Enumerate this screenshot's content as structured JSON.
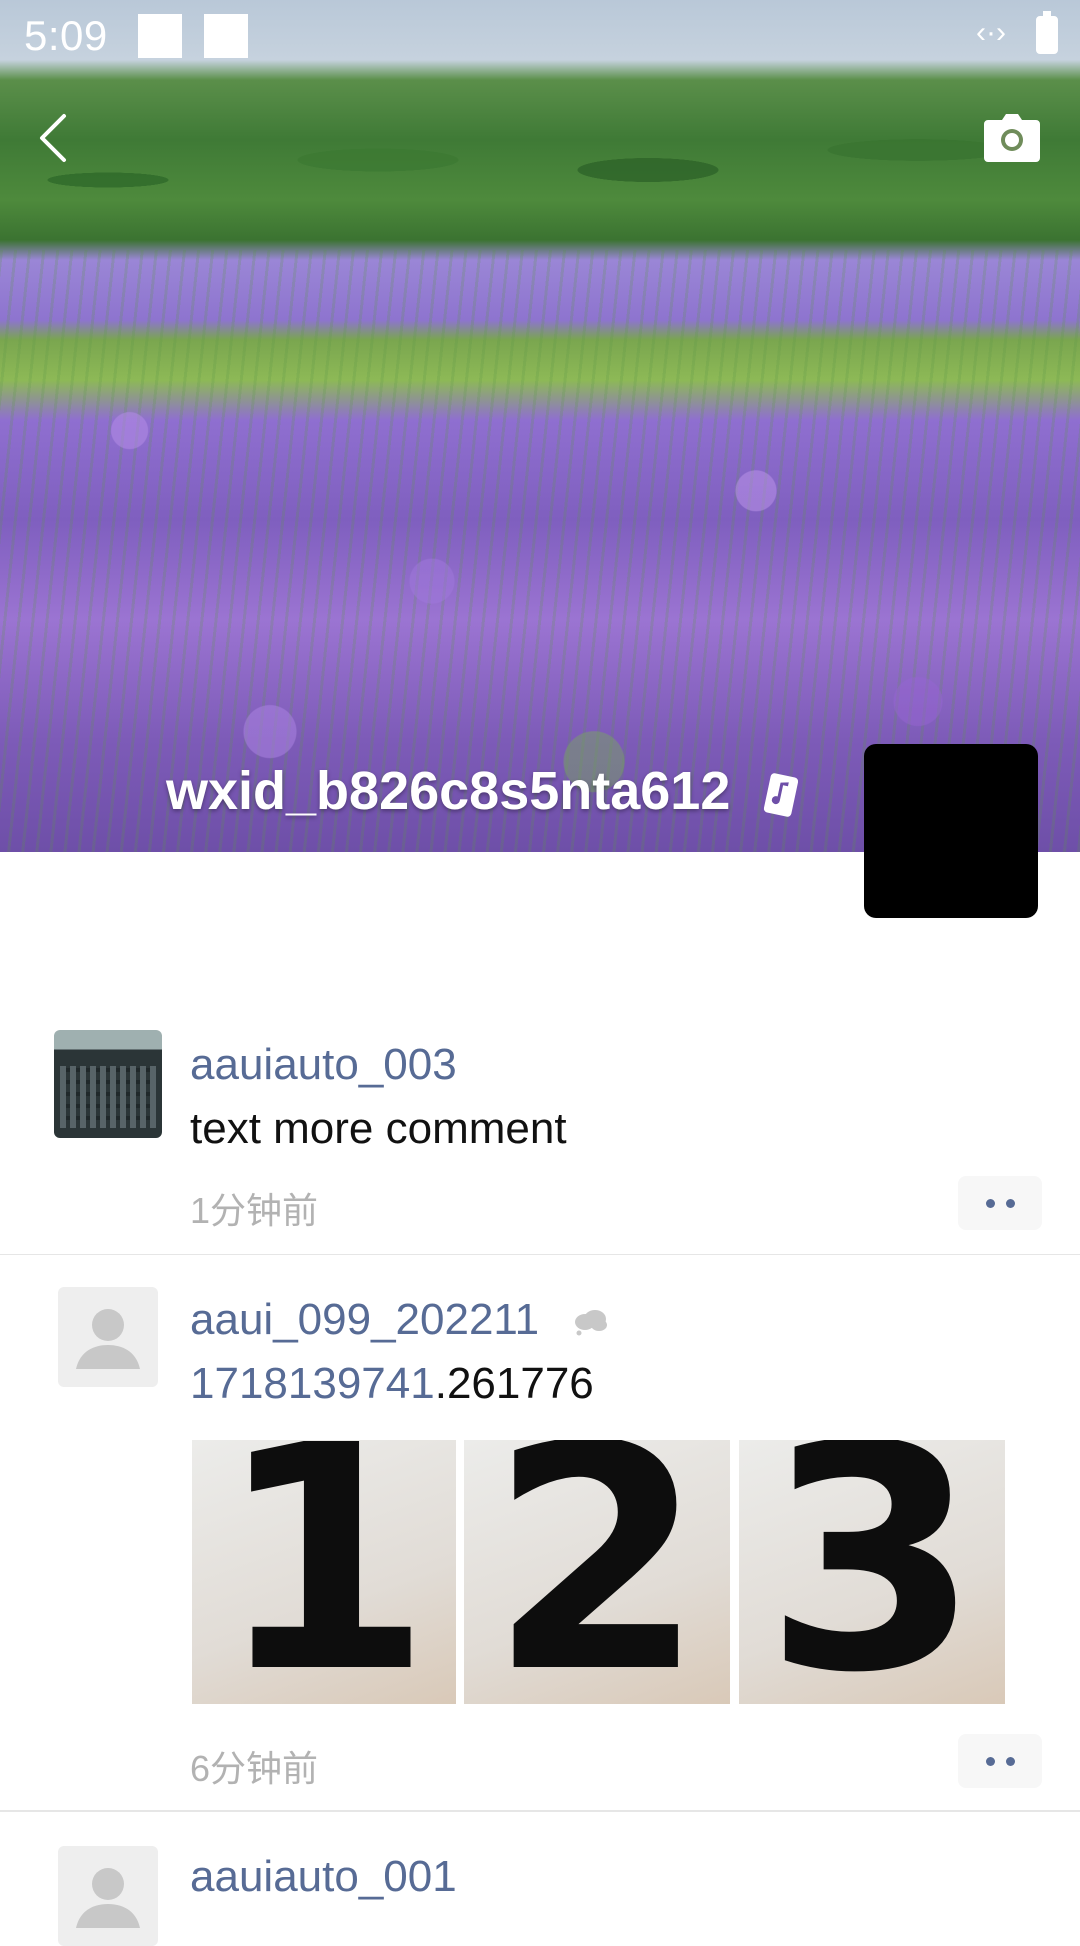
{
  "status_bar": {
    "time": "5:09",
    "right_indicator": "‹·›"
  },
  "header": {
    "back_icon": "chevron-left-icon",
    "camera_icon": "camera-icon",
    "profile_name": "wxid_b826c8s5nta612",
    "badge_icon": "music-note-badge-icon"
  },
  "posts": [
    {
      "username": "aauiauto_003",
      "content": "text more comment",
      "time": "1分钟前"
    },
    {
      "username": "aaui_099_202211",
      "content_link": "1718139741",
      "content_rest": ".261776",
      "images": [
        "1",
        "2",
        "3"
      ],
      "time": "6分钟前"
    },
    {
      "username": "aauiauto_001"
    }
  ],
  "colors": {
    "link": "#576b95",
    "timestamp": "#b2b2b2",
    "divider": "#e6e6e6"
  }
}
